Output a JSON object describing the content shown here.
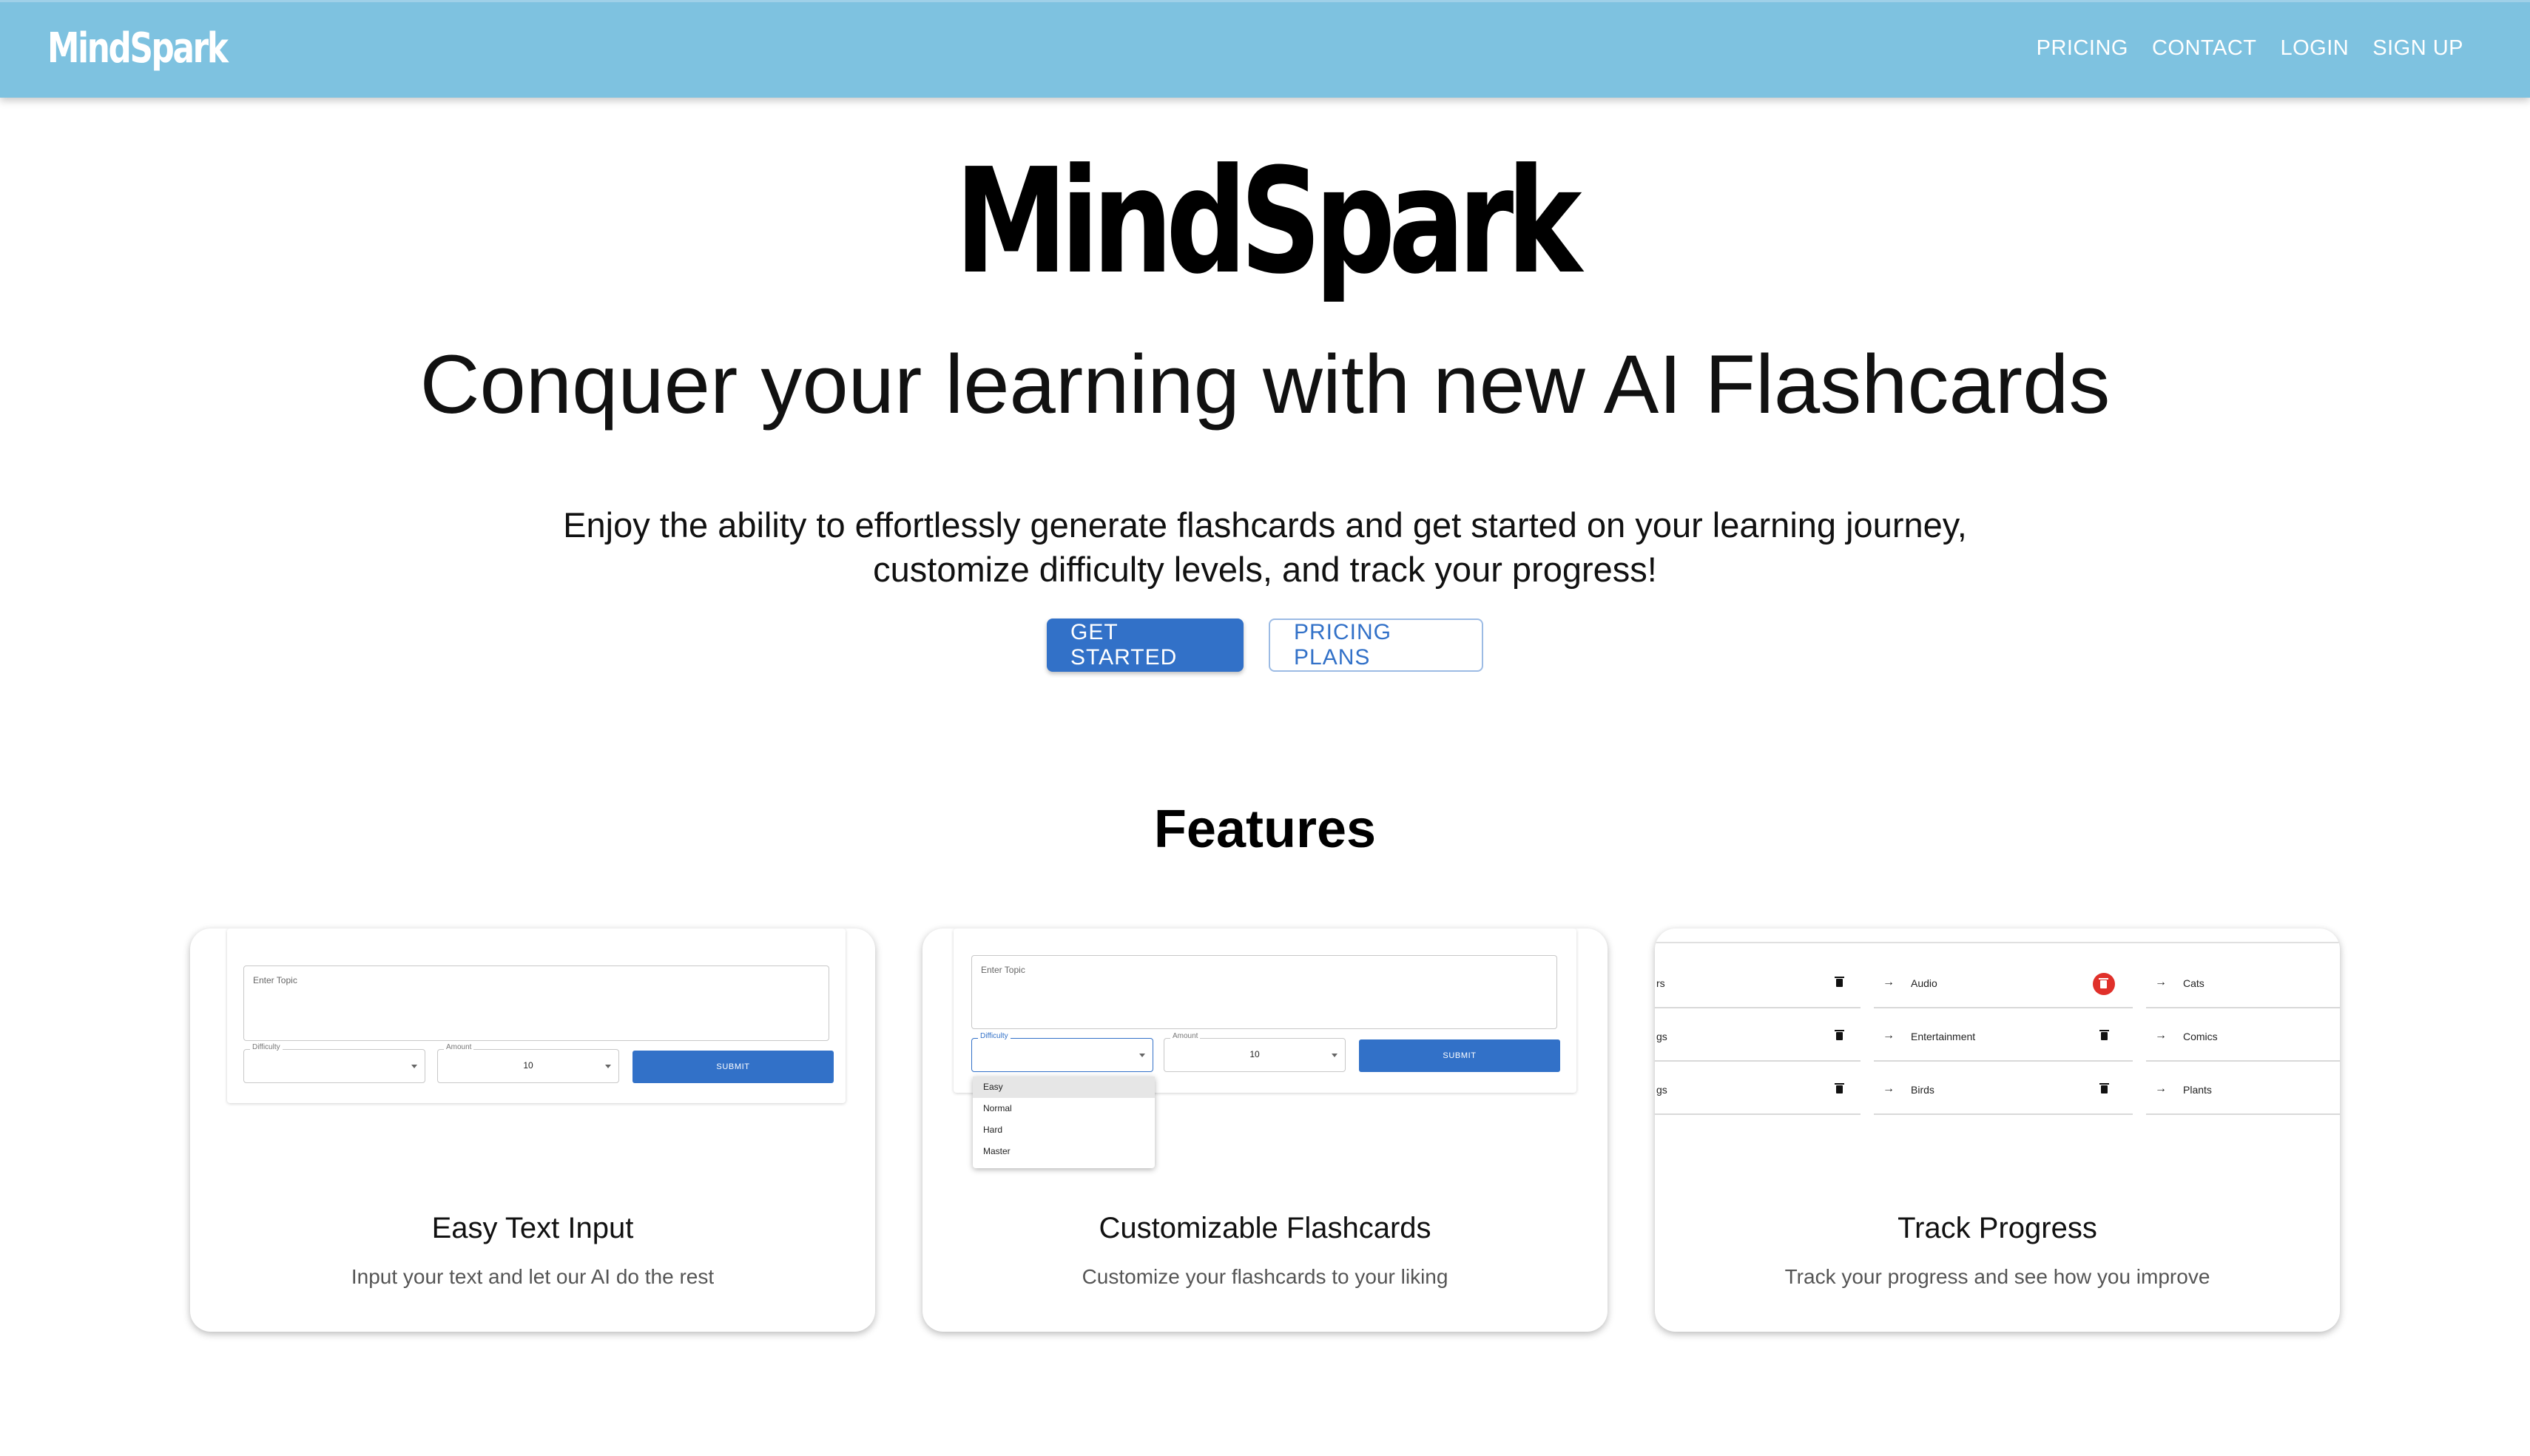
{
  "appbar": {
    "brand": "MindSpark",
    "nav": [
      "PRICING",
      "CONTACT",
      "LOGIN",
      "SIGN UP"
    ]
  },
  "hero": {
    "logo": "MindSpark",
    "title": "Conquer your learning with new AI Flashcards",
    "subtitle": "Enjoy the ability to effortlessly generate flashcards and get started on your learning journey, customize difficulty levels, and track your progress!",
    "primary_button": "GET STARTED",
    "secondary_button": "PRICING PLANS"
  },
  "features": {
    "title": "Features",
    "cards": [
      {
        "title": "Easy Text Input",
        "description": "Input your text and let our AI do the rest",
        "preview": {
          "topic_placeholder": "Enter Topic",
          "difficulty_label": "Difficulty",
          "amount_label": "Amount",
          "amount_value": "10",
          "submit_label": "SUBMIT"
        }
      },
      {
        "title": "Customizable Flashcards",
        "description": "Customize your flashcards to your liking",
        "preview": {
          "topic_placeholder": "Enter Topic",
          "difficulty_label": "Difficulty",
          "amount_label": "Amount",
          "amount_value": "10",
          "submit_label": "SUBMIT",
          "dropdown_options": [
            "Easy",
            "Normal",
            "Hard",
            "Master"
          ]
        }
      },
      {
        "title": "Track Progress",
        "description": "Track your progress and see how you improve",
        "preview": {
          "col1": [
            "rs",
            "gs",
            "gs"
          ],
          "col2": [
            "Audio",
            "Entertainment",
            "Birds"
          ],
          "col3": [
            "Cats",
            "Comics",
            "Plants"
          ],
          "arrow": "→"
        }
      }
    ]
  },
  "colors": {
    "appbar": "#7ec2e0",
    "primary": "#3271c8",
    "delete_active": "#e0302a"
  }
}
